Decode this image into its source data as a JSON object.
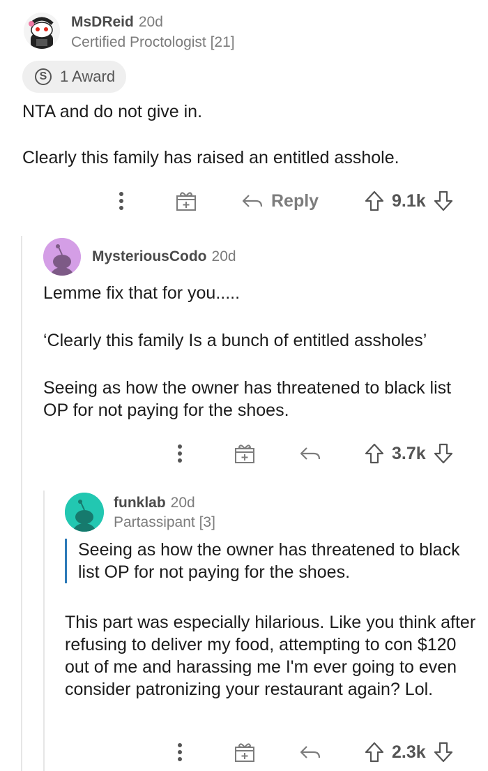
{
  "comments": [
    {
      "username": "MsDReid",
      "age": "20d",
      "flair": "Certified Proctologist [21]",
      "award": {
        "icon": "s-award-icon",
        "label": "1 Award"
      },
      "body": [
        "NTA and do not give in.",
        "Clearly this family has raised an entitled asshole."
      ],
      "actions": {
        "reply_label": "Reply",
        "score": "9.1k"
      }
    },
    {
      "username": "MysteriousCodo",
      "age": "20d",
      "avatar_color": "#d49ee6",
      "body": [
        "Lemme fix that for you.....",
        "‘Clearly this family Is a bunch of entitled assholes’",
        "Seeing as how the owner has threatened to black list OP for not paying for the shoes."
      ],
      "actions": {
        "score": "3.7k"
      }
    },
    {
      "username": "funklab",
      "age": "20d",
      "flair": "Partassipant [3]",
      "avatar_color": "#22c7b1",
      "quote": "Seeing as how the owner has threatened to black list OP for not paying for the shoes.",
      "body": [
        "This part was especially hilarious.  Like you think after refusing to deliver my food, attempting to con $120 out of me and harassing me I'm ever going to even consider patronizing your restaurant again?  Lol."
      ],
      "actions": {
        "score": "2.3k"
      }
    }
  ],
  "colors": {
    "thread_line": "#e6e6e6",
    "quote_bar": "#2c7ab8",
    "meta_gray": "#7c7c7c"
  }
}
